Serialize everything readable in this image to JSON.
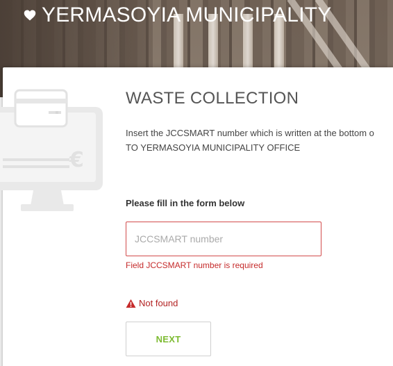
{
  "header": {
    "title": "YERMASOYIA MUNICIPALITY",
    "icon": "heart-icon"
  },
  "card": {
    "illustration_icon": "computer-payment-icon",
    "heading": "WASTE COLLECTION",
    "intro_line1": "Insert the JCCSMART number which is written at the bottom o",
    "intro_line2": "TO YERMASOYIA MUNICIPALITY OFFICE"
  },
  "form": {
    "prompt": "Please fill in the form below",
    "jcc_input": {
      "placeholder": "JCCSMART number",
      "value": ""
    },
    "jcc_error": "Field JCCSMART number is required",
    "not_found": "Not found",
    "next_label": "NEXT"
  },
  "colors": {
    "error": "#c52a2a",
    "accent_green": "#7dbb32"
  }
}
